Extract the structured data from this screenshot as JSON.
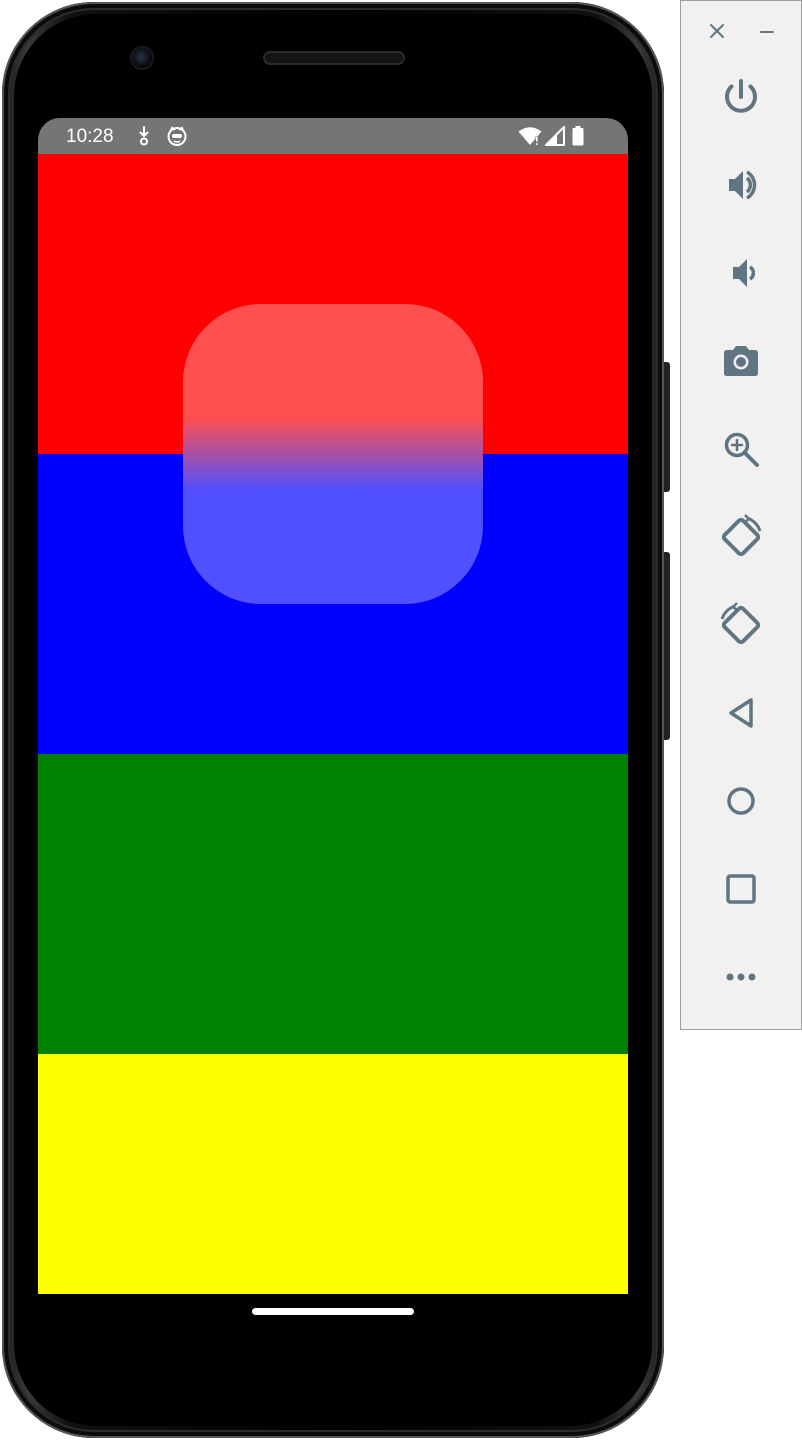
{
  "status_bar": {
    "time": "10:28",
    "left_icons": [
      "download-arrow-icon",
      "cat-face-icon"
    ],
    "right_icons": [
      "wifi-icon",
      "cell-signal-icon",
      "battery-icon"
    ],
    "background": "#757575"
  },
  "app": {
    "bands": [
      {
        "name": "red",
        "color": "#FF0000"
      },
      {
        "name": "blue",
        "color": "#0000FF"
      },
      {
        "name": "green",
        "color": "#008000"
      },
      {
        "name": "yellow",
        "color": "#FFFF00"
      }
    ],
    "overlay": {
      "gradient_top": "#FF5050",
      "gradient_bottom": "#5050FF"
    }
  },
  "toolbar": {
    "window_controls": [
      "close-icon",
      "minimize-icon"
    ],
    "buttons": [
      "power-icon",
      "volume-up-icon",
      "volume-down-icon",
      "camera-icon",
      "zoom-in-icon",
      "rotate-left-icon",
      "rotate-right-icon",
      "back-icon",
      "home-icon",
      "overview-icon",
      "more-icon"
    ],
    "icon_color": "#5f7581"
  }
}
